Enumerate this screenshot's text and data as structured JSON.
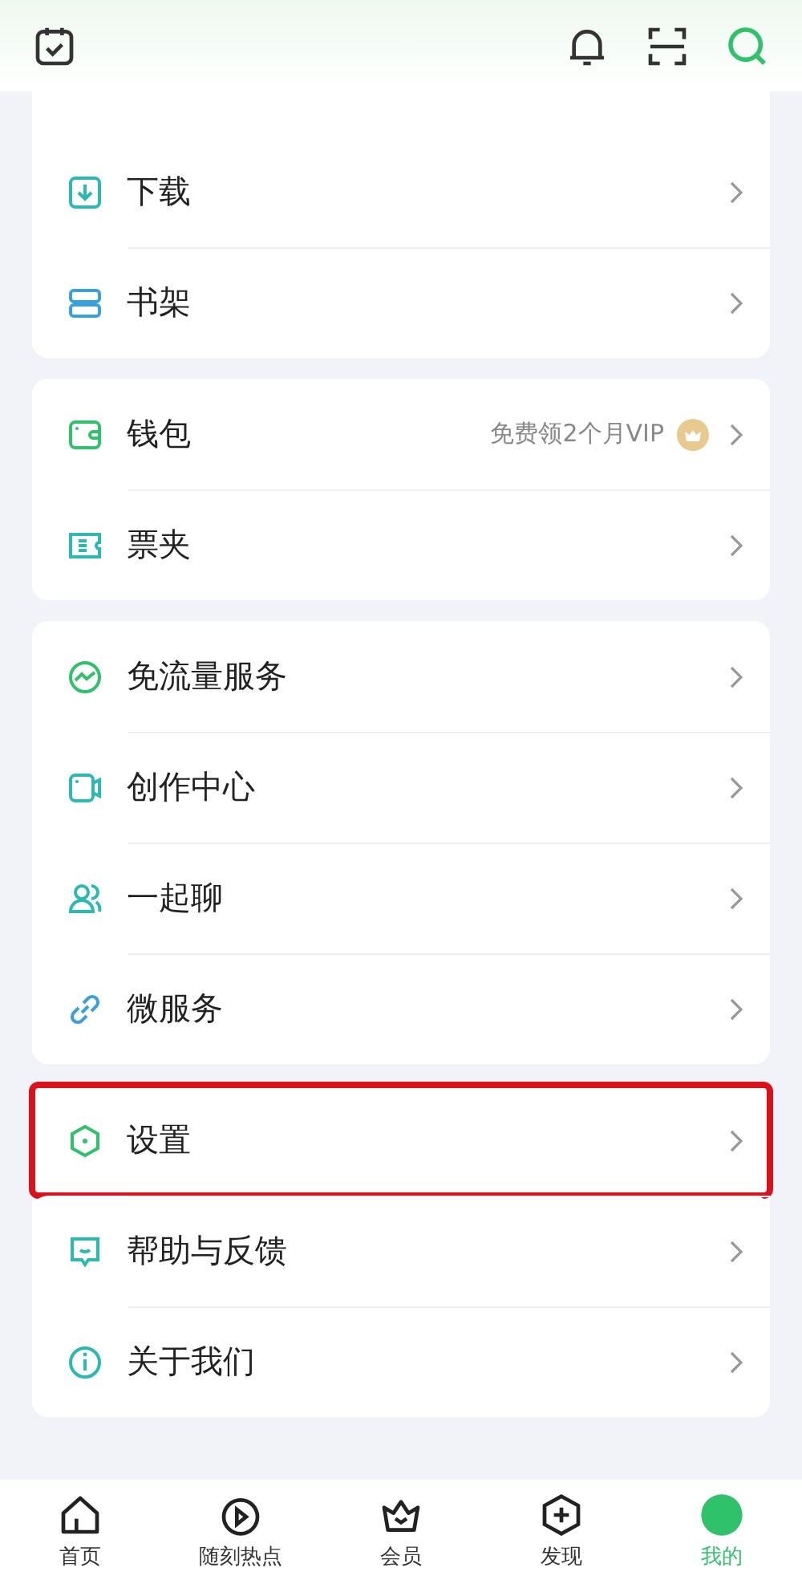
{
  "sections": [
    {
      "items": [
        {
          "label": "下载",
          "kind": "download",
          "highlighted": false
        },
        {
          "label": "书架",
          "kind": "shelf",
          "highlighted": false
        }
      ]
    },
    {
      "items": [
        {
          "label": "钱包",
          "kind": "wallet",
          "note": "免费领2个月VIP",
          "highlighted": false
        },
        {
          "label": "票夹",
          "kind": "ticket",
          "highlighted": false
        }
      ]
    },
    {
      "items": [
        {
          "label": "免流量服务",
          "kind": "traffic",
          "highlighted": false
        },
        {
          "label": "创作中心",
          "kind": "camera",
          "highlighted": false
        },
        {
          "label": "一起聊",
          "kind": "people",
          "highlighted": false
        },
        {
          "label": "微服务",
          "kind": "link",
          "highlighted": false
        }
      ]
    },
    {
      "items": [
        {
          "label": "设置",
          "kind": "hexagon",
          "highlighted": true
        },
        {
          "label": "帮助与反馈",
          "kind": "chat",
          "highlighted": false
        },
        {
          "label": "关于我们",
          "kind": "info",
          "highlighted": false
        }
      ]
    }
  ],
  "tabs": [
    {
      "label": "首页",
      "kind": "home",
      "selected": false
    },
    {
      "label": "随刻热点",
      "kind": "play",
      "selected": false
    },
    {
      "label": "会员",
      "kind": "crown",
      "selected": false
    },
    {
      "label": "发现",
      "kind": "plus",
      "selected": false
    },
    {
      "label": "我的",
      "kind": "avatar",
      "selected": true
    }
  ]
}
